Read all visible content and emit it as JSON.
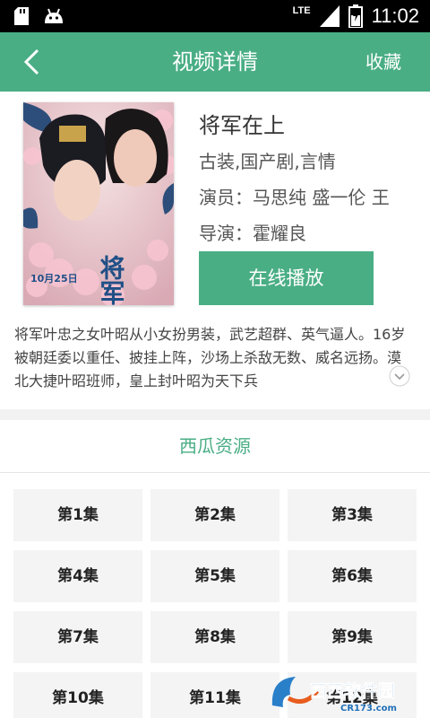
{
  "statusbar": {
    "time": "11:02",
    "network": "LTE"
  },
  "appbar": {
    "title": "视频详情",
    "favorite_label": "收藏"
  },
  "video": {
    "title": "将军在上",
    "genres": "古装,国产剧,言情",
    "cast": "演员：马思纯 盛一伦 王",
    "director": "导演：霍耀良",
    "play_label": "在线播放",
    "synopsis": "将军叶忠之女叶昭从小女扮男装，武艺超群、英气逼人。16岁被朝廷委以重任、披挂上阵，沙场上杀敌无数、威名远扬。漠北大捷叶昭班师，皇上封叶昭为天下兵",
    "poster_text": {
      "title": "将军在上",
      "date": "10月25日"
    }
  },
  "source": {
    "label": "西瓜资源"
  },
  "episodes": [
    "第1集",
    "第2集",
    "第3集",
    "第4集",
    "第5集",
    "第6集",
    "第7集",
    "第8集",
    "第9集",
    "第10集",
    "第11集",
    "第12集"
  ],
  "watermark": {
    "brand": "西西软件园",
    "url": "CR173.com"
  },
  "colors": {
    "accent": "#4aae85",
    "statusbar": "#000000",
    "episode_bg": "#f4f4f4"
  }
}
